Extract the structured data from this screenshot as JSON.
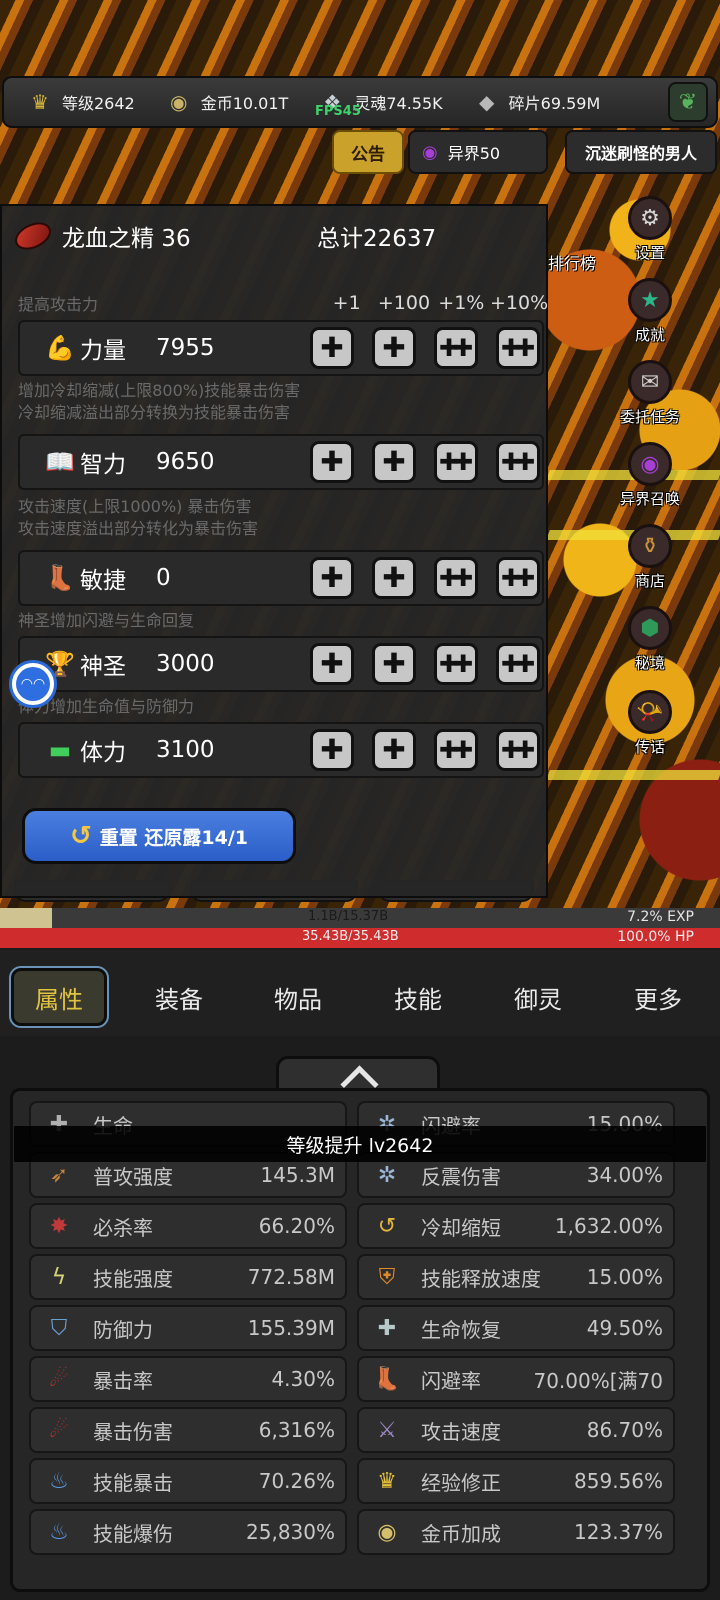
{
  "topbar": {
    "level": "等级2642",
    "gold": "金币10.01T",
    "soul": "灵魂74.55K",
    "fragments": "碎片69.59M",
    "fps": "FPS45"
  },
  "subbar": {
    "notice": "公告",
    "otherworld": "异界50",
    "player_name": "沉迷刷怪的男人"
  },
  "side_menu": [
    {
      "label": "设置",
      "icon": "gear-icon"
    },
    {
      "label": "成就",
      "icon": "star-icon"
    },
    {
      "label": "委托任务",
      "icon": "quest-icon"
    },
    {
      "label": "异界召唤",
      "icon": "portal-icon"
    },
    {
      "label": "商店",
      "icon": "shop-icon"
    },
    {
      "label": "秘境",
      "icon": "realm-icon"
    },
    {
      "label": "传话",
      "icon": "horn-icon"
    }
  ],
  "rank_label": "排行榜",
  "attr_panel": {
    "currency_name": "龙血之精 36",
    "total": "总计22637",
    "col_heads": [
      "+1",
      "+100",
      "+1%",
      "+10%"
    ],
    "sections": [
      {
        "desc": [
          "提高攻击力"
        ],
        "name": "力量",
        "value": "7955",
        "icon": "muscle-icon"
      },
      {
        "desc": [
          "增加冷却缩减(上限800%)技能暴击伤害",
          "冷却缩减溢出部分转换为技能暴击伤害"
        ],
        "name": "智力",
        "value": "9650",
        "icon": "book-icon"
      },
      {
        "desc": [
          "攻击速度(上限1000%) 暴击伤害",
          "攻击速度溢出部分转化为暴击伤害"
        ],
        "name": "敏捷",
        "value": "0",
        "icon": "boot-icon"
      },
      {
        "desc": [
          "神圣增加闪避与生命回复"
        ],
        "name": "神圣",
        "value": "3000",
        "icon": "trophy-icon"
      },
      {
        "desc": [
          "体力增加生命值与防御力"
        ],
        "name": "体力",
        "value": "3100",
        "icon": "dumbbell-icon"
      }
    ],
    "reset_label": "重置 还原露14/1"
  },
  "exp": {
    "text": "1.1B/15.37B",
    "pct": "7.2% EXP",
    "fill": 0.072
  },
  "hp": {
    "text": "35.43B/35.43B",
    "pct": "100.0%  HP",
    "fill": 1.0
  },
  "tabs": [
    "属性",
    "装备",
    "物品",
    "技能",
    "御灵",
    "更多"
  ],
  "toast": "等级提升 lv2642",
  "stats": [
    {
      "name": "生命",
      "value": "",
      "icon": "health-cross-icon"
    },
    {
      "name": "闪避率",
      "value": "15.00%",
      "icon": "ice-icon"
    },
    {
      "name": "普攻强度",
      "value": "145.3M",
      "icon": "arrow-icon"
    },
    {
      "name": "反震伤害",
      "value": "34.00%",
      "icon": "ice-icon"
    },
    {
      "name": "必杀率",
      "value": "66.20%",
      "icon": "blood-icon"
    },
    {
      "name": "冷却缩短",
      "value": "1,632.00%",
      "icon": "cooldown-icon"
    },
    {
      "name": "技能强度",
      "value": "772.58M",
      "icon": "lightning-icon"
    },
    {
      "name": "技能释放速度",
      "value": "15.00%",
      "icon": "shield-fire-icon"
    },
    {
      "name": "防御力",
      "value": "155.39M",
      "icon": "shield-icon"
    },
    {
      "name": "生命恢复",
      "value": "49.50%",
      "icon": "regen-icon"
    },
    {
      "name": "暴击率",
      "value": "4.30%",
      "icon": "claw-icon"
    },
    {
      "name": "闪避率",
      "value": "70.00%[满70",
      "icon": "boot-icon"
    },
    {
      "name": "暴击伤害",
      "value": "6,316%",
      "icon": "claw-icon"
    },
    {
      "name": "攻击速度",
      "value": "86.70%",
      "icon": "sword-icon"
    },
    {
      "name": "技能暴击",
      "value": "70.26%",
      "icon": "blue-flame-icon"
    },
    {
      "name": "经验修正",
      "value": "859.56%",
      "icon": "crown-icon"
    },
    {
      "name": "技能爆伤",
      "value": "25,830%",
      "icon": "blue-flame-icon"
    },
    {
      "name": "金币加成",
      "value": "123.37%",
      "icon": "coin-icon"
    }
  ],
  "colors": {
    "active_tab_text": "#e2c441",
    "reset_button": "#2b5ec7",
    "hp_fill": "#cf2d2d",
    "exp_fill": "#cfc392"
  }
}
